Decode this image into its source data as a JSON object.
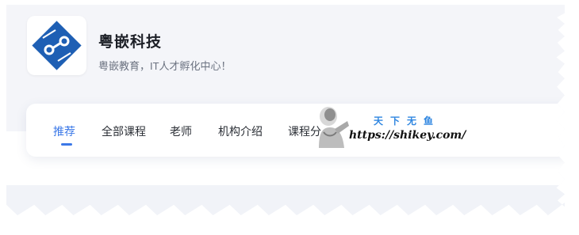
{
  "org": {
    "name": "粤嵌科技",
    "slogan": "粤嵌教育，IT人才孵化中心！"
  },
  "nav": {
    "tabs": [
      {
        "label": "推荐",
        "active": true
      },
      {
        "label": "全部课程",
        "active": false
      },
      {
        "label": "老师",
        "active": false
      },
      {
        "label": "机构介绍",
        "active": false
      },
      {
        "label": "课程分",
        "active": false
      }
    ]
  },
  "watermark": {
    "title": "天下无鱼",
    "url": "https://shikey.com/"
  },
  "colors": {
    "accent": "#3b78e7",
    "logo_blue": "#1e5fb4",
    "page_bg": "#f4f5f9",
    "watermark_title": "#2f86e0"
  },
  "icons": {
    "logo": "yueqian-logo-icon",
    "watermark_figure": "bust-figure-icon"
  }
}
